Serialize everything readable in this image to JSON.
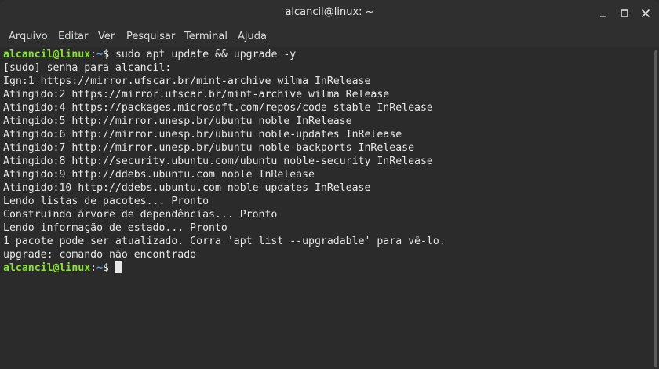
{
  "window": {
    "title": "alcancil@linux: ~"
  },
  "menu": {
    "items": [
      "Arquivo",
      "Editar",
      "Ver",
      "Pesquisar",
      "Terminal",
      "Ajuda"
    ]
  },
  "prompt": {
    "user_host": "alcancil@linux",
    "sep": ":",
    "path": "~",
    "symbol": "$ "
  },
  "command": "sudo apt update && upgrade -y",
  "output": [
    "[sudo] senha para alcancil:",
    "Ign:1 https://mirror.ufscar.br/mint-archive wilma InRelease",
    "Atingido:2 https://mirror.ufscar.br/mint-archive wilma Release",
    "Atingido:4 https://packages.microsoft.com/repos/code stable InRelease",
    "Atingido:5 http://mirror.unesp.br/ubuntu noble InRelease",
    "Atingido:6 http://mirror.unesp.br/ubuntu noble-updates InRelease",
    "Atingido:7 http://mirror.unesp.br/ubuntu noble-backports InRelease",
    "Atingido:8 http://security.ubuntu.com/ubuntu noble-security InRelease",
    "Atingido:9 http://ddebs.ubuntu.com noble InRelease",
    "Atingido:10 http://ddebs.ubuntu.com noble-updates InRelease",
    "Lendo listas de pacotes... Pronto",
    "Construindo árvore de dependências... Pronto",
    "Lendo informação de estado... Pronto",
    "1 pacote pode ser atualizado. Corra 'apt list --upgradable' para vê-lo.",
    "upgrade: comando não encontrado"
  ],
  "colors": {
    "background": "#2b2b2b",
    "prompt_user": "#8ae234",
    "prompt_path": "#729fcf",
    "text": "#e8e8e8"
  }
}
